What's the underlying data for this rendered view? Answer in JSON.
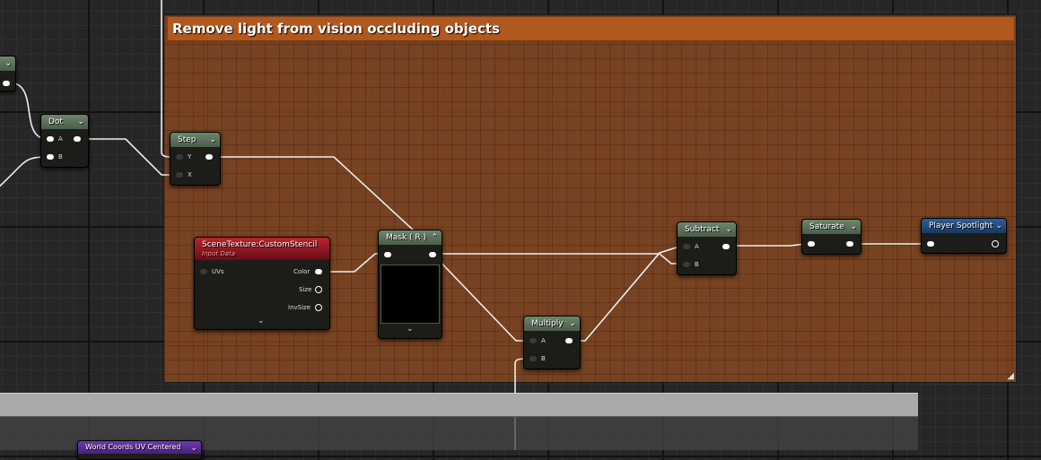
{
  "comment": {
    "title": "Remove light from vision occluding objects",
    "color": "#b1581f"
  },
  "nodes": {
    "dot": {
      "title": "Dot",
      "pins": {
        "a": "A",
        "b": "B"
      }
    },
    "step": {
      "title": "Step",
      "pins": {
        "y": "Y",
        "x": "X"
      }
    },
    "scene_texture": {
      "title": "SceneTexture:CustomStencil",
      "subtitle": "Input Data",
      "pins": {
        "uvs": "UVs",
        "color": "Color",
        "size": "Size",
        "invsize": "InvSize"
      }
    },
    "mask": {
      "title": "Mask ( R )"
    },
    "multiply": {
      "title": "Multiply",
      "pins": {
        "a": "A",
        "b": "B"
      }
    },
    "subtract": {
      "title": "Subtract",
      "pins": {
        "a": "A",
        "b": "B"
      }
    },
    "saturate": {
      "title": "Saturate"
    },
    "player_spotlight": {
      "title": "Player Spotlight"
    },
    "world_coords": {
      "title": "World Coords UV Centered"
    }
  },
  "icons": {
    "collapse": "chevron-down-icon",
    "expand": "chevron-up-icon",
    "resize": "resize-grip-icon"
  },
  "colors": {
    "material_node_header": "#5a6e58",
    "texture_node_header": "#9a1a24",
    "parameter_node_header": "#244d80",
    "function_node_header": "#5c2f95",
    "wire": "#ffffff"
  }
}
